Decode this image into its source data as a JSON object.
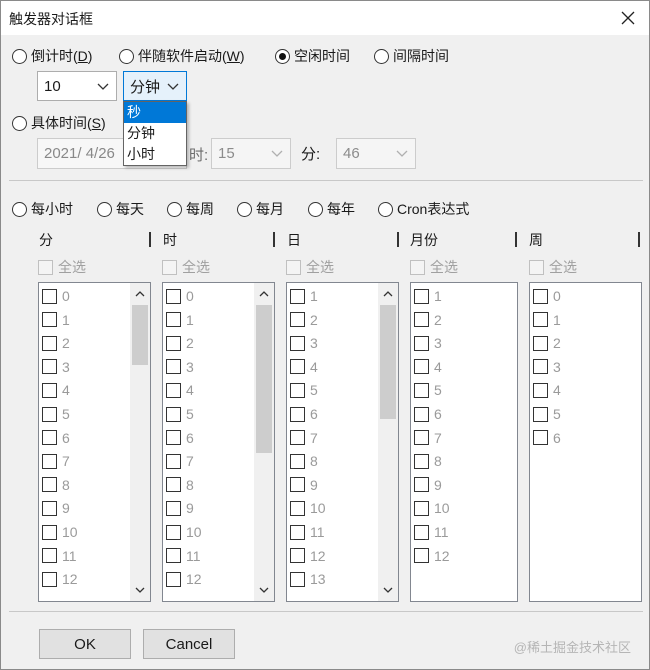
{
  "window": {
    "title": "触发器对话框"
  },
  "mode_options": [
    {
      "label": "倒计时(",
      "key": "D",
      "end": ")"
    },
    {
      "label": "伴随软件启动(",
      "key": "W",
      "end": ")"
    },
    {
      "label": "空闲时间",
      "key": "",
      "end": ""
    },
    {
      "label": "间隔时间",
      "key": "",
      "end": ""
    }
  ],
  "selected_mode": "空闲时间",
  "amount": {
    "value": "10"
  },
  "unit": {
    "value": "分钟",
    "options": [
      "秒",
      "分钟",
      "小时"
    ],
    "highlighted": "秒"
  },
  "specific_time": {
    "label": "具体时间(",
    "key": "S",
    "end": ")",
    "date_value": "2021/ 4/26",
    "hour_label_partial": "时:",
    "hour_value": "15",
    "minute_label": "分:",
    "minute_value": "46"
  },
  "frequency_options": [
    "每小时",
    "每天",
    "每周",
    "每月",
    "每年",
    "Cron表达式"
  ],
  "columns": [
    {
      "header": "分",
      "select_all": "全选",
      "items": [
        "0",
        "1",
        "2",
        "3",
        "4",
        "5",
        "6",
        "7",
        "8",
        "9",
        "10",
        "11",
        "12"
      ]
    },
    {
      "header": "时",
      "select_all": "全选",
      "items": [
        "0",
        "1",
        "2",
        "3",
        "4",
        "5",
        "6",
        "7",
        "8",
        "9",
        "10",
        "11",
        "12"
      ]
    },
    {
      "header": "日",
      "select_all": "全选",
      "items": [
        "1",
        "2",
        "3",
        "4",
        "5",
        "6",
        "7",
        "8",
        "9",
        "10",
        "11",
        "12",
        "13"
      ]
    },
    {
      "header": "月份",
      "select_all": "全选",
      "items": [
        "1",
        "2",
        "3",
        "4",
        "5",
        "6",
        "7",
        "8",
        "9",
        "10",
        "11",
        "12"
      ]
    },
    {
      "header": "周",
      "select_all": "全选",
      "items": [
        "0",
        "1",
        "2",
        "3",
        "4",
        "5",
        "6"
      ]
    }
  ],
  "buttons": {
    "ok": "OK",
    "cancel": "Cancel"
  },
  "watermark": "@稀土掘金技术社区"
}
